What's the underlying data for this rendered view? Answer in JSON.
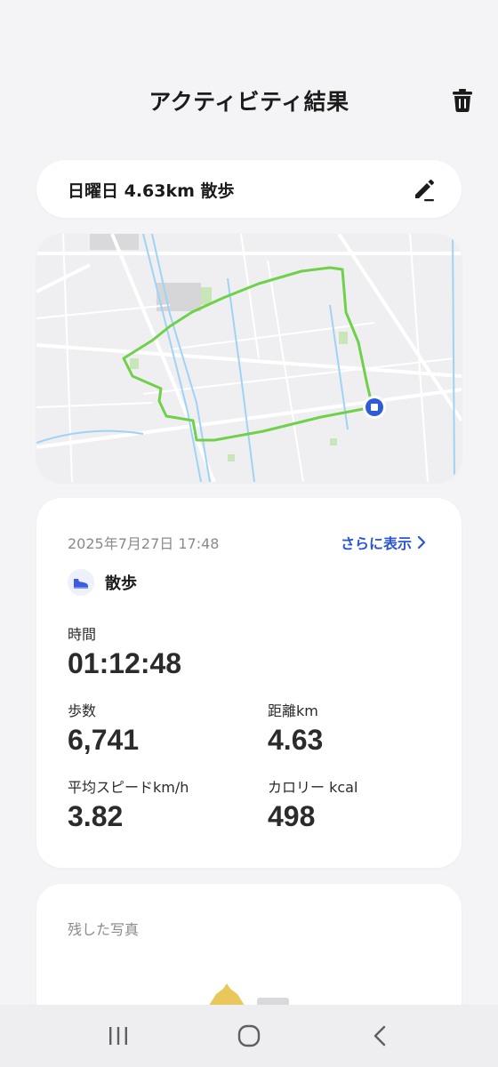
{
  "header": {
    "title": "アクティビティ結果",
    "delete_icon": "trash-icon"
  },
  "summary": {
    "title": "日曜日 4.63km 散歩",
    "edit_icon": "pencil-icon"
  },
  "map": {
    "route_color": "#6fd14a",
    "current_location_color": "#2f5bd9"
  },
  "details": {
    "datetime": "2025年7月27日 17:48",
    "more_label": "さらに表示",
    "activity_type": "散歩",
    "activity_icon": "shoe-icon",
    "accent_color": "#2a55d4",
    "stats": {
      "duration_label": "時間",
      "duration_value": "01:12:48",
      "steps_label": "歩数",
      "steps_value": "6,741",
      "distance_label": "距離km",
      "distance_value": "4.63",
      "speed_label": "平均スピードkm/h",
      "speed_value": "3.82",
      "calories_label": "カロリー kcal",
      "calories_value": "498"
    }
  },
  "photos": {
    "label": "残した写真"
  },
  "navbar": {
    "recent_icon": "recent-apps-icon",
    "home_icon": "home-icon",
    "back_icon": "back-icon"
  }
}
